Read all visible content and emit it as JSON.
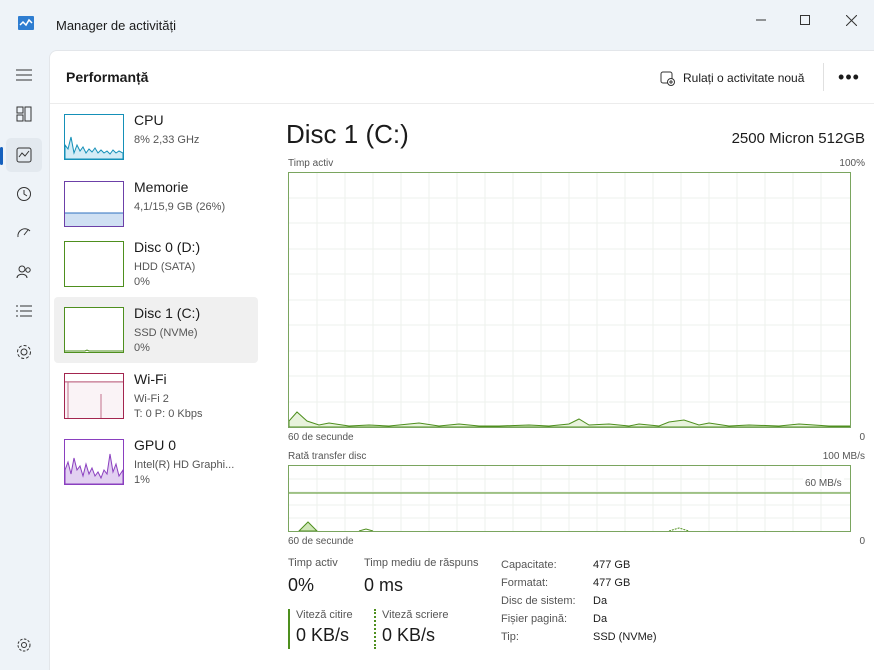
{
  "window": {
    "title": "Manager de activități"
  },
  "header": {
    "page_title": "Performanță",
    "run_task_label": "Rulați o activitate nouă",
    "more": "•••"
  },
  "nav": {
    "icons": [
      "menu-icon",
      "processes-icon",
      "performance-icon",
      "history-icon",
      "startup-icon",
      "users-icon",
      "details-icon",
      "services-icon",
      "settings-icon"
    ]
  },
  "list": [
    {
      "name": "CPU",
      "line1": "8%  2,33 GHz"
    },
    {
      "name": "Memorie",
      "line1": "4,1/15,9 GB (26%)"
    },
    {
      "name": "Disc 0 (D:)",
      "line1": "HDD (SATA)",
      "line2": "0%"
    },
    {
      "name": "Disc 1 (C:)",
      "line1": "SSD (NVMe)",
      "line2": "0%"
    },
    {
      "name": "Wi-Fi",
      "line1": "Wi-Fi 2",
      "line2": "T: 0 P: 0 Kbps"
    },
    {
      "name": "GPU 0",
      "line1": "Intel(R) HD Graphi...",
      "line2": "1%"
    }
  ],
  "detail": {
    "title": "Disc 1 (C:)",
    "model": "2500 Micron 512GB",
    "graph1": {
      "label": "Timp activ",
      "max": "100%",
      "time": "60 de secunde",
      "min": "0"
    },
    "graph2": {
      "label": "Rată transfer disc",
      "max": "100 MB/s",
      "inner": "60 MB/s",
      "time": "60 de secunde",
      "min": "0"
    },
    "stats": {
      "active_time_label": "Timp activ",
      "active_time_value": "0%",
      "response_label": "Timp mediu de răspuns",
      "response_value": "0 ms",
      "read_label": "Viteză citire",
      "read_value": "0 KB/s",
      "write_label": "Viteză scriere",
      "write_value": "0 KB/s"
    },
    "props": [
      {
        "k": "Capacitate:",
        "v": "477 GB"
      },
      {
        "k": "Formatat:",
        "v": "477 GB"
      },
      {
        "k": "Disc de sistem:",
        "v": "Da"
      },
      {
        "k": "Fișier pagină:",
        "v": "Da"
      },
      {
        "k": "Tip:",
        "v": "SSD (NVMe)"
      }
    ]
  },
  "colors": {
    "disk": "#4e8f1e",
    "cpu": "#1590b8",
    "memory": "#6c40a8",
    "wifi": "#a3254f",
    "gpu": "#8a3fbf"
  }
}
